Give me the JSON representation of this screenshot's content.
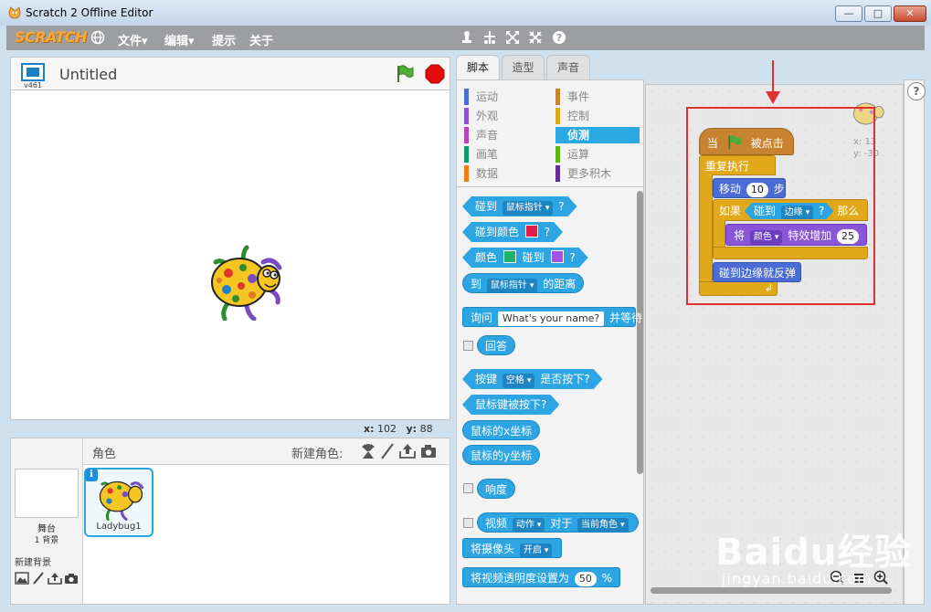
{
  "window": {
    "title": "Scratch 2 Offline Editor",
    "min": "—",
    "max": "□",
    "close": "✕"
  },
  "menubar": {
    "logo": "SCRATCH",
    "items": [
      "文件▾",
      "编辑▾",
      "提示",
      "关于"
    ]
  },
  "stage": {
    "version": "v461",
    "project_title": "Untitled",
    "mouse_x_label": "x:",
    "mouse_x": "102",
    "mouse_y_label": "y:",
    "mouse_y": "88"
  },
  "sprites_panel": {
    "sprites_label": "角色",
    "new_sprite_label": "新建角色:",
    "stage_name": "舞台",
    "stage_backdrop_count": "1 背景",
    "new_backdrop_label": "新建背景",
    "sprite_name": "Ladybug1",
    "info": "i"
  },
  "tabs": [
    "脚本",
    "造型",
    "声音"
  ],
  "categories": [
    {
      "label": "运动",
      "color": "#4a6cd4"
    },
    {
      "label": "事件",
      "color": "#c88330"
    },
    {
      "label": "外观",
      "color": "#8a55d7"
    },
    {
      "label": "控制",
      "color": "#e1a91a"
    },
    {
      "label": "声音",
      "color": "#bb42c3"
    },
    {
      "label": "侦测",
      "color": "#2ca5e2"
    },
    {
      "label": "画笔",
      "color": "#0e9a6c"
    },
    {
      "label": "运算",
      "color": "#5cb712"
    },
    {
      "label": "数据",
      "color": "#ee7d16"
    },
    {
      "label": "更多积木",
      "color": "#632d99"
    }
  ],
  "palette": {
    "touching": "碰到",
    "mouse_pointer": "鼠标指针",
    "q": "?",
    "touching_color": "碰到颜色",
    "color_label": "颜色",
    "touching2": "碰到",
    "distance_to": "到",
    "distance_suffix": "的距离",
    "ask": "询问",
    "ask_default": "What's your name?",
    "ask_suffix": "并等待",
    "answer": "回答",
    "key": "按键",
    "space": "空格",
    "key_suffix": "是否按下?",
    "mouse_down": "鼠标键被按下?",
    "mouse_x": "鼠标的x坐标",
    "mouse_y": "鼠标的y坐标",
    "loudness": "响度",
    "video": "视频",
    "motion": "动作",
    "on": "对于",
    "current_sprite": "当前角色",
    "turn_video": "将摄像头",
    "video_on": "开启",
    "set_transparency": "将视频透明度设置为",
    "transparency_val": "50",
    "percent": "%"
  },
  "script": {
    "when": "当",
    "clicked": "被点击",
    "forever": "重复执行",
    "move": "移动",
    "steps_val": "10",
    "steps": "步",
    "if": "如果",
    "touching": "碰到",
    "edge": "边缘",
    "q": "?",
    "then": "那么",
    "change": "将",
    "effect": "颜色",
    "effect_by": "特效增加",
    "effect_val": "25",
    "bounce": "碰到边缘就反弹",
    "loop_arrow": "↲"
  },
  "sprite_info": {
    "x": "x: 13",
    "y": "y: -30"
  },
  "help": "?",
  "watermark": {
    "main": "Baidu经验",
    "sub": "jingyan.baidu.com"
  }
}
